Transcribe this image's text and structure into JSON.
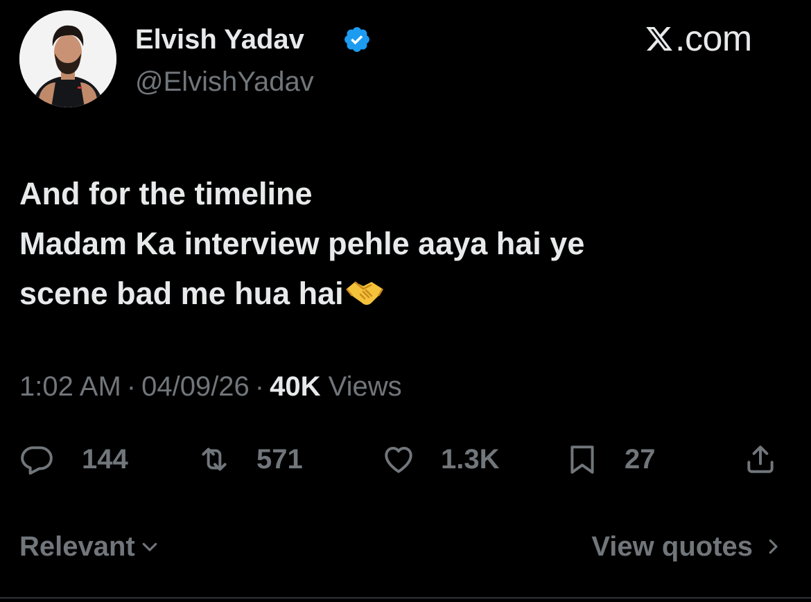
{
  "author": {
    "display_name": "Elvish Yadav",
    "handle": "@ElvishYadav",
    "verified_color": "#1d9bf0"
  },
  "site": {
    "domain": ".com"
  },
  "tweet": {
    "lines": [
      "And for the timeline",
      "Madam Ka interview pehle aaya hai ye",
      "scene bad me hua hai"
    ],
    "emoji": "handshake-emoji"
  },
  "meta": {
    "time": "1:02 AM",
    "date": "04/09/26",
    "views_count": "40K",
    "views_label": "Views",
    "separator": "·"
  },
  "actions": {
    "replies": "144",
    "reposts": "571",
    "likes": "1.3K",
    "bookmarks": "27"
  },
  "footer": {
    "sort_label": "Relevant",
    "quotes_label": "View quotes"
  },
  "colors": {
    "background": "#000000",
    "text_primary": "#e7e9ea",
    "text_secondary": "#71767b",
    "accent": "#1d9bf0"
  }
}
